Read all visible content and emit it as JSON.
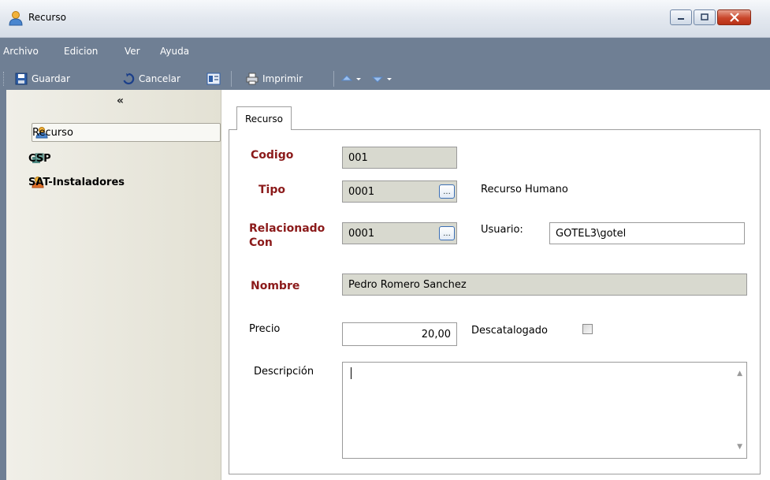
{
  "window": {
    "title": "Recurso",
    "icon": "user-icon"
  },
  "menu": {
    "items": [
      {
        "label": "Archivo",
        "name": "menu-archivo"
      },
      {
        "label": "Edicion",
        "name": "menu-edicion"
      },
      {
        "label": "Ver",
        "name": "menu-ver"
      },
      {
        "label": "Ayuda",
        "name": "menu-ayuda"
      }
    ]
  },
  "toolbar": {
    "guardar": "Guardar",
    "cancelar": "Cancelar",
    "imprimir": "Imprimir"
  },
  "sidebar": {
    "collapse": "«",
    "items": [
      {
        "label": "Recurso",
        "selected": true,
        "icon": "user-icon"
      },
      {
        "label": "CSP",
        "selected": false,
        "icon": "cards-icon"
      },
      {
        "label": "SAT-Instaladores",
        "selected": false,
        "icon": "user-icon"
      }
    ]
  },
  "tab": {
    "label": "Recurso"
  },
  "form": {
    "codigo_label": "Codigo",
    "codigo_value": "001",
    "tipo_label": "Tipo",
    "tipo_value": "0001",
    "tipo_desc": "Recurso Humano",
    "relacionado_label_1": "Relacionado",
    "relacionado_label_2": "Con",
    "relacionado_value": "0001",
    "usuario_label": "Usuario:",
    "usuario_value": "GOTEL3\\gotel",
    "nombre_label": "Nombre",
    "nombre_value": "Pedro Romero Sanchez",
    "precio_label": "Precio",
    "precio_value": "20,00",
    "descatalogado_label": "Descatalogado",
    "descatalogado_checked": false,
    "descripcion_label": "Descripción",
    "descripcion_value": "",
    "lookup_label": "..."
  },
  "colors": {
    "frame": "#6f7f94",
    "label_red": "#8b1a1a",
    "field_bg": "#d8d9cf"
  }
}
